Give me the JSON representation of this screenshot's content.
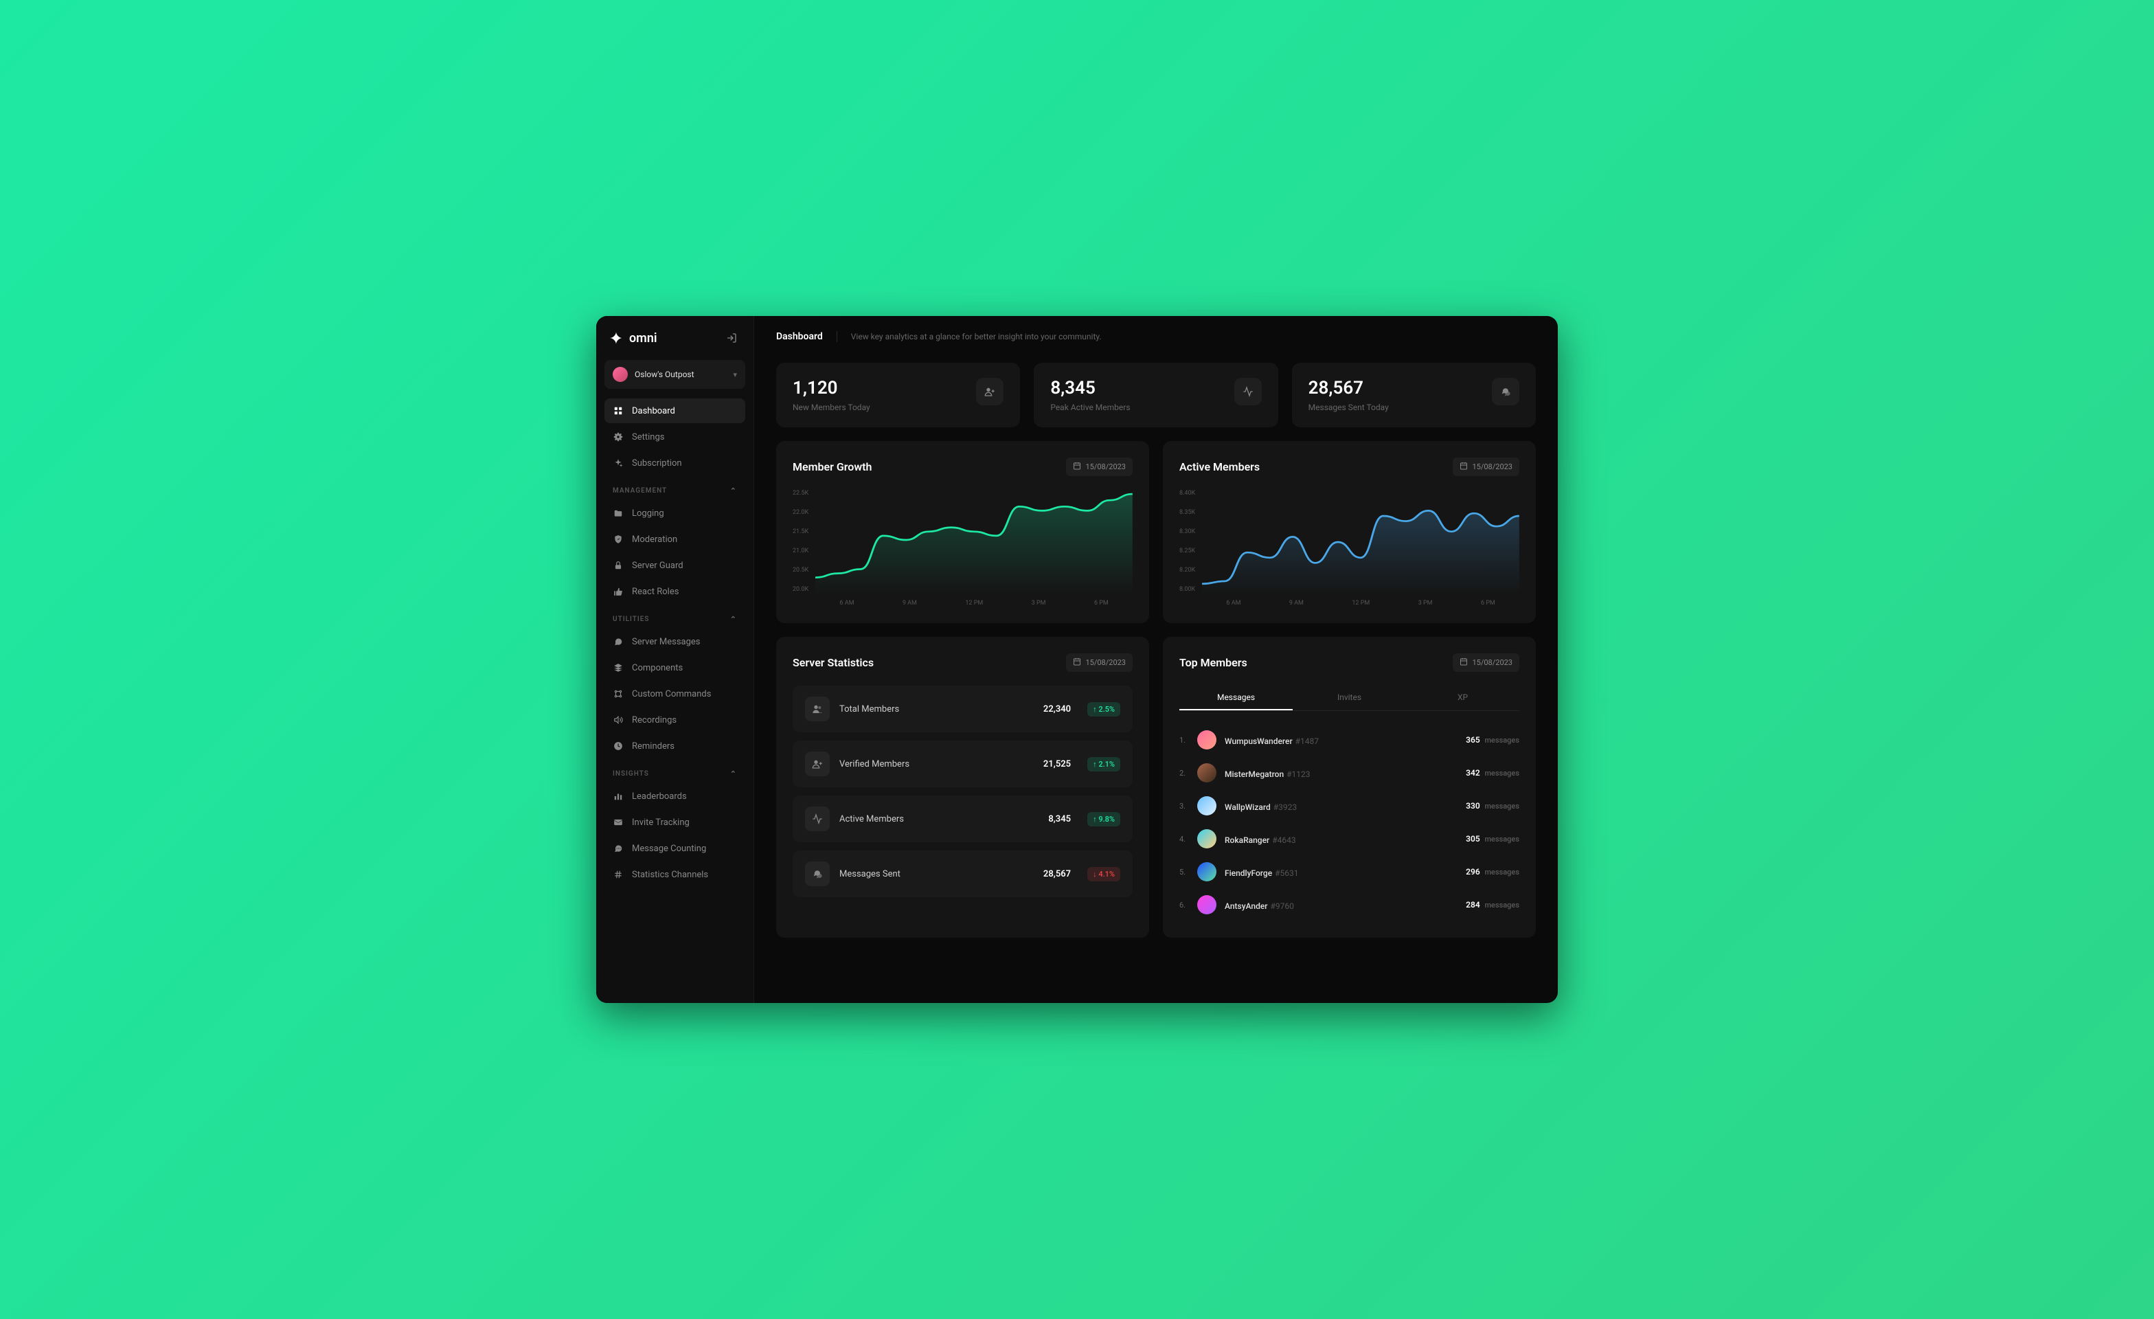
{
  "brand": "omni",
  "server": {
    "name": "Oslow's Outpost"
  },
  "nav": {
    "top": [
      {
        "label": "Dashboard",
        "icon": "grid-icon",
        "active": true
      },
      {
        "label": "Settings",
        "icon": "gear-icon"
      },
      {
        "label": "Subscription",
        "icon": "sparkle-icon"
      }
    ],
    "sections": [
      {
        "title": "MANAGEMENT",
        "items": [
          {
            "label": "Logging",
            "icon": "folder-icon"
          },
          {
            "label": "Moderation",
            "icon": "shield-icon"
          },
          {
            "label": "Server Guard",
            "icon": "lock-icon"
          },
          {
            "label": "React Roles",
            "icon": "thumbs-up-icon"
          }
        ]
      },
      {
        "title": "UTILITIES",
        "items": [
          {
            "label": "Server Messages",
            "icon": "chat-icon"
          },
          {
            "label": "Components",
            "icon": "layers-icon"
          },
          {
            "label": "Custom Commands",
            "icon": "command-icon"
          },
          {
            "label": "Recordings",
            "icon": "volume-icon"
          },
          {
            "label": "Reminders",
            "icon": "clock-icon"
          }
        ]
      },
      {
        "title": "INSIGHTS",
        "items": [
          {
            "label": "Leaderboards",
            "icon": "bars-icon"
          },
          {
            "label": "Invite Tracking",
            "icon": "mail-icon"
          },
          {
            "label": "Message Counting",
            "icon": "chat-count-icon"
          },
          {
            "label": "Statistics Channels",
            "icon": "hash-icon"
          }
        ]
      }
    ]
  },
  "header": {
    "title": "Dashboard",
    "subtitle": "View key analytics at a glance for better insight into your community."
  },
  "stat_cards": [
    {
      "value": "1,120",
      "label": "New Members Today",
      "icon": "user-plus-icon"
    },
    {
      "value": "8,345",
      "label": "Peak Active Members",
      "icon": "activity-icon"
    },
    {
      "value": "28,567",
      "label": "Messages Sent Today",
      "icon": "messages-icon"
    }
  ],
  "charts": {
    "growth": {
      "title": "Member Growth",
      "date": "15/08/2023",
      "color": "#1de9a3"
    },
    "active": {
      "title": "Active Members",
      "date": "15/08/2023",
      "color": "#4aa8e8"
    }
  },
  "chart_data": [
    {
      "type": "line",
      "title": "Member Growth",
      "xlabel": "",
      "ylabel": "",
      "ylim": [
        20000,
        22500
      ],
      "y_ticks": [
        "22.5K",
        "22.0K",
        "21.5K",
        "21.0K",
        "20.5K",
        "20.0K"
      ],
      "categories": [
        "6 AM",
        "9 AM",
        "12 PM",
        "3 PM",
        "6 PM"
      ],
      "values": [
        20400,
        20500,
        20600,
        21400,
        21300,
        21500,
        21600,
        21500,
        21400,
        22100,
        22000,
        22100,
        22000,
        22250,
        22400
      ]
    },
    {
      "type": "line",
      "title": "Active Members",
      "xlabel": "",
      "ylabel": "",
      "ylim": [
        8200,
        8400
      ],
      "y_ticks": [
        "8.40K",
        "8.35K",
        "8.30K",
        "8.25K",
        "8.20K",
        "8.00K"
      ],
      "categories": [
        "6 AM",
        "9 AM",
        "12 PM",
        "3 PM",
        "6 PM"
      ],
      "values": [
        8220,
        8225,
        8280,
        8270,
        8310,
        8260,
        8300,
        8270,
        8350,
        8340,
        8360,
        8320,
        8355,
        8330,
        8350
      ]
    }
  ],
  "server_stats": {
    "title": "Server Statistics",
    "date": "15/08/2023",
    "rows": [
      {
        "label": "Total Members",
        "value": "22,340",
        "change": "2.5%",
        "dir": "up",
        "icon": "users-icon"
      },
      {
        "label": "Verified Members",
        "value": "21,525",
        "change": "2.1%",
        "dir": "up",
        "icon": "user-plus-icon"
      },
      {
        "label": "Active Members",
        "value": "8,345",
        "change": "9.8%",
        "dir": "up",
        "icon": "activity-icon"
      },
      {
        "label": "Messages Sent",
        "value": "28,567",
        "change": "4.1%",
        "dir": "down",
        "icon": "messages-icon"
      }
    ]
  },
  "top_members": {
    "title": "Top Members",
    "date": "15/08/2023",
    "tabs": [
      "Messages",
      "Invites",
      "XP"
    ],
    "active_tab": 0,
    "unit": "messages",
    "list": [
      {
        "rank": "1.",
        "name": "WumpusWanderer",
        "discrim": "#1487",
        "count": "365",
        "avatar_bg": "linear-gradient(135deg,#ff6b9d,#fda085)"
      },
      {
        "rank": "2.",
        "name": "MisterMegatron",
        "discrim": "#1123",
        "count": "342",
        "avatar_bg": "linear-gradient(135deg,#a8654a,#3a2a1a)"
      },
      {
        "rank": "3.",
        "name": "WallpWizard",
        "discrim": "#3923",
        "count": "330",
        "avatar_bg": "linear-gradient(135deg,#6ac0ff,#e0f0ff)"
      },
      {
        "rank": "4.",
        "name": "RokaRanger",
        "discrim": "#4643",
        "count": "305",
        "avatar_bg": "linear-gradient(135deg,#3ad0f0,#ffd080)"
      },
      {
        "rank": "5.",
        "name": "FiendlyForge",
        "discrim": "#5631",
        "count": "296",
        "avatar_bg": "linear-gradient(135deg,#2050ff,#60e0a0)"
      },
      {
        "rank": "6.",
        "name": "AntsyAnder",
        "discrim": "#9760",
        "count": "284",
        "avatar_bg": "linear-gradient(135deg,#ff40e0,#b060ff)"
      }
    ]
  }
}
